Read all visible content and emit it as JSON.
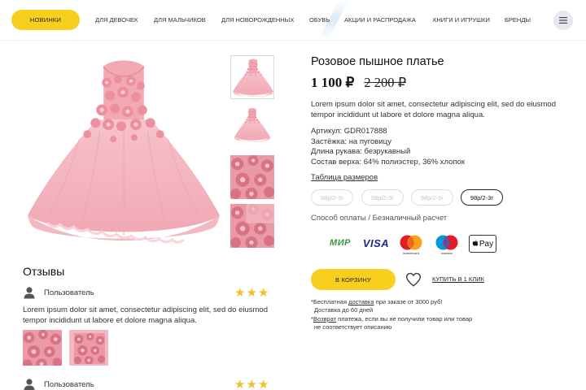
{
  "header": {
    "new_label": "Новинки",
    "nav": [
      "Для девочек",
      "Для мальчиков",
      "Для новорожденных",
      "Обувь",
      "Акции и распродажа",
      "Книги и игрушки",
      "Бренды"
    ],
    "menu_icon": "hamburger-menu-icon"
  },
  "product": {
    "title": "Розовое пышное платье",
    "price": "1 100 ₽",
    "old_price": "2 200 ₽",
    "description": "Lorem ipsum dolor sit amet, consectetur adipiscing elit, sed do eiusmod tempor incididunt ut labore et dolore magna aliqua.",
    "specs": [
      "Артикул: GDR017888",
      "Застёжка: на пуговицу",
      "Длина рукава: безрукавный",
      "Состав верха: 64% полиэстер, 36% хлопок"
    ],
    "size_table_link": "Таблица размеров",
    "sizes": [
      "98р/2-3г",
      "98р/2-3г",
      "98р/2-3г",
      "98р/2-3г"
    ],
    "selected_size_index": 3,
    "payment_label": "Способ оплаты / Безналичный расчет",
    "payment_methods": {
      "mir": "МИР",
      "visa": "VISA",
      "mastercard": "mastercard",
      "maestro": "maestro",
      "applepay": "Pay"
    },
    "cart_button": "В корзину",
    "favorite_icon": "heart-icon",
    "buy_one_click": "Купить в 1 клик",
    "delivery_note": {
      "prefix": "*Бесплатная ",
      "link": "доставка",
      "suffix": " при заказе от 3000 руб!",
      "line2": "Доставка до 60 дней"
    },
    "return_note": {
      "prefix": "*",
      "link": "Возврат",
      "suffix": " платежа, если вы не получили товар или товар",
      "line2": "не соответствует описанию"
    }
  },
  "reviews": {
    "title": "Отзывы",
    "items": [
      {
        "user": "Пользователь",
        "stars": "★★★",
        "text": "Lorem ipsum dolor sit amet, consectetur adipiscing elit, sed do eiusmod tempor incididunt ut labore et dolore magna aliqua."
      },
      {
        "user": "Пользователь",
        "stars": "★★★"
      }
    ]
  },
  "colors": {
    "accent": "#f7cf1c",
    "star": "#f2c029",
    "dress_pink": "#f4b7c0",
    "menu_bg": "#e8e7f2"
  }
}
